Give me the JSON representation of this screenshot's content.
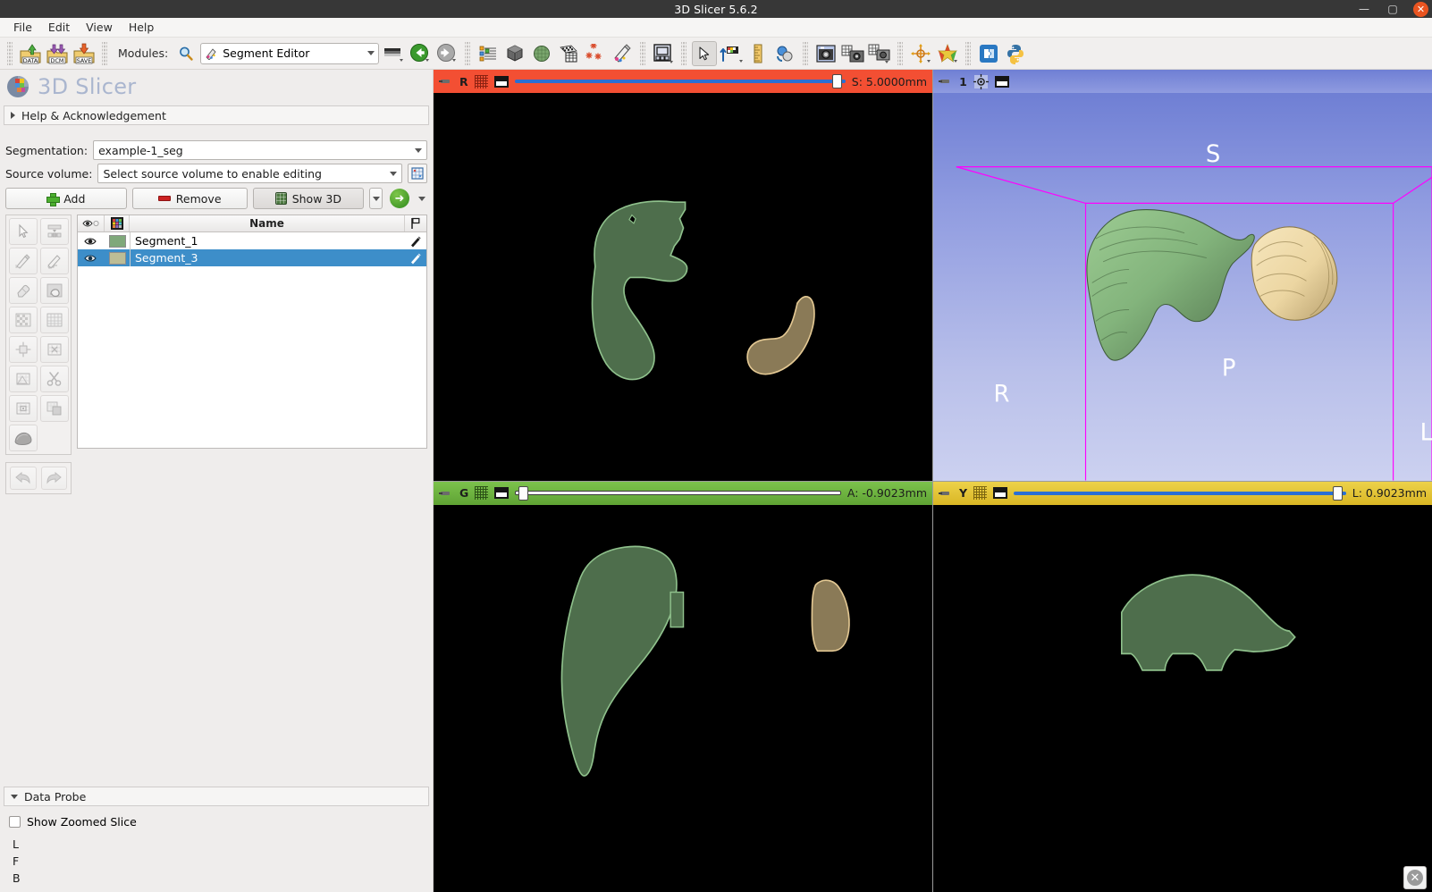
{
  "window": {
    "title": "3D Slicer 5.6.2",
    "minimize_label": "—",
    "maximize_label": "▢",
    "close_label": "✕"
  },
  "menu": {
    "items": [
      {
        "label": "File"
      },
      {
        "label": "Edit"
      },
      {
        "label": "View"
      },
      {
        "label": "Help"
      }
    ]
  },
  "toolbar": {
    "modules_label": "Modules:",
    "search_icon": "magnifier-icon",
    "module_selected": "Segment Editor",
    "buttons": [
      {
        "name": "load-data-button",
        "icon": "data-folder-icon",
        "label": "DATA"
      },
      {
        "name": "load-dicom-button",
        "icon": "dicom-folder-icon",
        "label": "DCM"
      },
      {
        "name": "save-data-button",
        "icon": "save-folder-icon",
        "label": "SAVE"
      },
      {
        "name": "favorite-modules-button",
        "icon": "gradient-bar-icon",
        "label": ""
      },
      {
        "name": "module-back-button",
        "icon": "back-arrow-icon",
        "label": ""
      },
      {
        "name": "module-forward-button",
        "icon": "forward-arrow-icon",
        "label": ""
      },
      {
        "name": "subject-hierarchy-button",
        "icon": "tree-hierarchy-icon",
        "label": ""
      },
      {
        "name": "volumes-button",
        "icon": "volume-cube-icon",
        "label": ""
      },
      {
        "name": "models-button",
        "icon": "model-sphere-icon",
        "label": ""
      },
      {
        "name": "volume-rendering-button",
        "icon": "volume-rendering-icon",
        "label": ""
      },
      {
        "name": "markups-button",
        "icon": "markups-fiducials-icon",
        "label": ""
      },
      {
        "name": "segment-editor-button",
        "icon": "segment-editor-icon",
        "label": ""
      },
      {
        "name": "layout-button",
        "icon": "layout-grid-icon",
        "label": ""
      },
      {
        "name": "mouse-mode-button",
        "icon": "mouse-pointer-icon",
        "label": ""
      },
      {
        "name": "place-markup-button",
        "icon": "place-markup-icon",
        "label": ""
      },
      {
        "name": "ruler-button",
        "icon": "ruler-icon",
        "label": ""
      },
      {
        "name": "show-slice-views-button",
        "icon": "slice-views-icon",
        "label": ""
      },
      {
        "name": "screenshot-button",
        "icon": "camera-icon",
        "label": ""
      },
      {
        "name": "scene-views-button",
        "icon": "scene-view-capture-icon",
        "label": ""
      },
      {
        "name": "capture-button",
        "icon": "screen-capture-icon",
        "label": ""
      },
      {
        "name": "crosshair-button",
        "icon": "crosshair-icon",
        "label": ""
      },
      {
        "name": "color-button",
        "icon": "color-star-icon",
        "label": ""
      },
      {
        "name": "extensions-button",
        "icon": "extensions-icon",
        "label": ""
      },
      {
        "name": "python-console-button",
        "icon": "python-icon",
        "label": ""
      }
    ]
  },
  "brand": {
    "name": "3D Slicer",
    "logo_icon": "slicer-logo-icon"
  },
  "panel": {
    "help_section_label": "Help & Acknowledgement",
    "segmentation_label": "Segmentation:",
    "segmentation_value": "example-1_seg",
    "source_volume_label": "Source volume:",
    "source_volume_value": "Select source volume to enable editing",
    "source_volume_icon": "specify-geometry-icon",
    "add_label": "Add",
    "remove_label": "Remove",
    "show3d_label": "Show 3D",
    "go_to_segmentations_icon": "green-arrow-right-icon",
    "effects": [
      {
        "name": "effect-none",
        "icon": "cursor-arrow-icon"
      },
      {
        "name": "effect-threshold",
        "icon": "threshold-icon"
      },
      {
        "name": "effect-paint",
        "icon": "paint-brush-icon"
      },
      {
        "name": "effect-draw",
        "icon": "draw-pencil-icon"
      },
      {
        "name": "effect-erase",
        "icon": "eraser-icon"
      },
      {
        "name": "effect-level-tracing",
        "icon": "level-tracing-icon"
      },
      {
        "name": "effect-grow-from-seeds",
        "icon": "grow-from-seeds-icon"
      },
      {
        "name": "effect-fill-between-slices",
        "icon": "fill-between-slices-icon"
      },
      {
        "name": "effect-margin",
        "icon": "margin-icon"
      },
      {
        "name": "effect-smoothing",
        "icon": "smoothing-icon"
      },
      {
        "name": "effect-islands",
        "icon": "islands-icon"
      },
      {
        "name": "effect-scissors",
        "icon": "scissors-icon"
      },
      {
        "name": "effect-logical-operators",
        "icon": "logical-operators-icon"
      },
      {
        "name": "effect-mask-volume",
        "icon": "mask-volume-icon"
      },
      {
        "name": "effect-local-threshold",
        "icon": "local-threshold-icon"
      }
    ],
    "undo_icon": "undo-arrow-icon",
    "redo_icon": "redo-arrow-icon",
    "table": {
      "headers": {
        "visibility": "eye-icon",
        "color": "color-table-icon",
        "name": "Name",
        "flag": "flag-icon"
      },
      "rows": [
        {
          "name": "Segment_1",
          "color": "#7fa87a",
          "visible": true,
          "selected": false,
          "edit_icon": "pencil-icon"
        },
        {
          "name": "Segment_3",
          "color": "#bdbd96",
          "visible": true,
          "selected": true,
          "edit_icon": "pencil-icon"
        }
      ]
    },
    "data_probe_label": "Data Probe",
    "show_zoomed_slice_label": "Show Zoomed Slice",
    "probe_lines": [
      "L",
      "F",
      "B"
    ]
  },
  "views": {
    "red": {
      "name": "Red",
      "letter": "R",
      "color": "#f34f33",
      "coordinate": "S: 5.0000mm",
      "slider_percent": 99,
      "pin_icon": "pin-icon",
      "visibility_icon": "slice-visibility-icon",
      "layout_icon": "view-layout-icon"
    },
    "threed": {
      "name": "1",
      "letter": "1",
      "color": "#7f8dd8",
      "pin_icon": "pin-icon",
      "center_icon": "center-view-icon",
      "layout_icon": "view-layout-icon",
      "orientation_labels": {
        "superior": "S",
        "posterior": "P",
        "right": "R",
        "left": "L"
      },
      "box_color": "#ff00ff"
    },
    "green": {
      "name": "Green",
      "letter": "G",
      "color": "#6cb33f",
      "coordinate": "A: -0.9023mm",
      "slider_percent": 1,
      "pin_icon": "pin-icon",
      "visibility_icon": "slice-visibility-icon",
      "layout_icon": "view-layout-icon"
    },
    "yellow": {
      "name": "Yellow",
      "letter": "Y",
      "color": "#e4c334",
      "coordinate": "L: 0.9023mm",
      "slider_percent": 99,
      "pin_icon": "pin-icon",
      "visibility_icon": "slice-visibility-icon",
      "layout_icon": "view-layout-icon"
    }
  },
  "segment_colors": {
    "segment_1_fill": "#4e6e4c",
    "segment_1_outline": "#8fc18c",
    "segment_3_fill": "#8a7a57",
    "segment_3_outline": "#e3c893",
    "model_green": "#84b57e",
    "model_tan": "#e9d5a4"
  },
  "bottom": {
    "close_icon": "close-circle-icon"
  }
}
